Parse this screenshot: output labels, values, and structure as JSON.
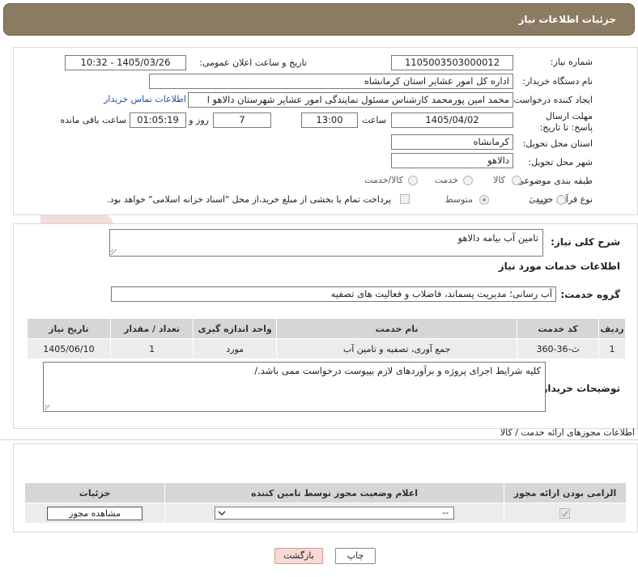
{
  "header": {
    "title": "جزئیات اطلاعات نیاز"
  },
  "form": {
    "need_number_label": "شماره نیاز:",
    "need_number": "1105003503000012",
    "announce_label": "تاریخ و ساعت اعلان عمومی:",
    "announce_value": "1405/03/26 - 10:32",
    "buyer_org_label": "نام دستگاه خریدار:",
    "buyer_org": "اداره کل امور عشایر استان کرمانشاه",
    "creator_label": "ایجاد کننده درخواست:",
    "creator": "محمد امین پورمحمد کارشناس مسئول نمایندگی امور عشایر شهرستان دالاهو ا",
    "contact_link": "اطلاعات تماس خریدار",
    "deadline_label": "مهلت ارسال پاسخ: تا تاریخ:",
    "deadline_date": "1405/04/02",
    "time_label": "ساعت",
    "deadline_time": "13:00",
    "days_value": "7",
    "days_label": "روز و",
    "remaining_time": "01:05:19",
    "remaining_label": "ساعت باقی مانده",
    "province_label": "استان محل تحویل:",
    "province": "کرمانشاه",
    "city_label": "شهر محل تحویل:",
    "city": "دالاهو",
    "category_label": "طبقه بندی موضوعی:",
    "category_options": [
      "کالا",
      "خدمت",
      "کالا/خدمت"
    ],
    "process_label": "نوع فرآیند خرید :",
    "process_options": [
      "جزیی",
      "متوسط"
    ],
    "payment_note": "پرداخت تمام یا بخشی از مبلغ خرید،از محل \"اسناد خزانه اسلامی\" خواهد بود."
  },
  "summary": {
    "label": "شرح کلی نیاز:",
    "value": "تامین آب بیامه دالاهو",
    "services_heading": "اطلاعات خدمات مورد نیاز",
    "group_label": "گروه خدمت:",
    "group_value": "آب رسانی؛ مدیریت پسماند، فاضلاب و فعالیت های تصفیه"
  },
  "services_table": {
    "headers": [
      "ردیف",
      "کد خدمت",
      "نام خدمت",
      "واحد اندازه گیری",
      "تعداد / مقدار",
      "تاریخ نیاز"
    ],
    "rows": [
      [
        "1",
        "ث-36-360",
        "جمع آوری، تصفیه و تامین آب",
        "مورد",
        "1",
        "1405/06/10"
      ]
    ]
  },
  "buyer_notes": {
    "label": "توضیحات خریدار:",
    "value": "کلیه شرایط اجرای پروژه و برآوردهای لازم بپیوست درخواست ممی باشد./"
  },
  "permits": {
    "section_title": "اطلاعات مجوزهای ارائه خدمت / کالا",
    "headers": [
      "الزامی بودن ارائه مجوز",
      "اعلام وضعیت مجوز توسط تامین کننده",
      "جزئیات"
    ],
    "select_value": "--",
    "view_button": "مشاهده مجوز"
  },
  "footer": {
    "print_button": "چاپ",
    "back_button": "بازگشت"
  },
  "colors": {
    "header_bg": "#8b7b62",
    "back_button_bg": "#f8d7d7",
    "link": "#1f4fa8"
  }
}
